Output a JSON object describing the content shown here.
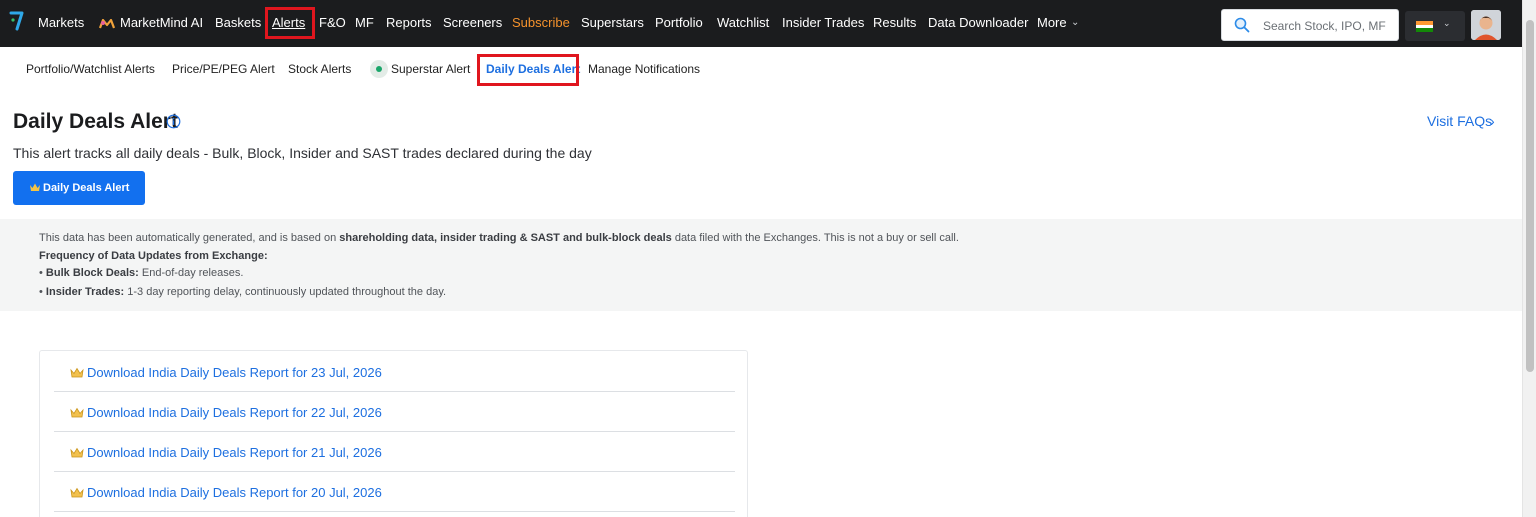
{
  "topnav": {
    "items": [
      {
        "label": "Markets"
      },
      {
        "label": "MarketMind AI"
      },
      {
        "label": "Baskets"
      },
      {
        "label": "Alerts"
      },
      {
        "label": "F&O"
      },
      {
        "label": "MF"
      },
      {
        "label": "Reports"
      },
      {
        "label": "Screeners"
      },
      {
        "label": "Subscribe"
      },
      {
        "label": "Superstars"
      },
      {
        "label": "Portfolio"
      },
      {
        "label": "Watchlist"
      },
      {
        "label": "Insider Trades"
      },
      {
        "label": "Results"
      },
      {
        "label": "Data Downloader"
      },
      {
        "label": "More"
      }
    ],
    "search_placeholder": "Search Stock, IPO, MF",
    "country_flag": "india-flag-icon",
    "accent_subscribe": "#f5922c"
  },
  "subtabs": {
    "items": [
      {
        "label": "Portfolio/Watchlist Alerts"
      },
      {
        "label": "Price/PE/PEG Alert"
      },
      {
        "label": "Stock Alerts"
      },
      {
        "label": "Superstar Alert"
      },
      {
        "label": "Daily Deals Alert"
      },
      {
        "label": "Manage Notifications"
      }
    ],
    "active": "Daily Deals Alert"
  },
  "header": {
    "title": "Daily Deals Alert",
    "faq_link": "Visit FAQs",
    "subtitle": "This alert tracks all daily deals - Bulk, Block, Insider and SAST trades declared during the day",
    "cta_label": "Daily Deals Alert"
  },
  "disclaimer": {
    "line1_pre": "This data has been automatically generated, and is based on ",
    "line1_bold": "shareholding data, insider trading & SAST and bulk-block deals",
    "line1_post": " data filed with the Exchanges. This is not a buy or sell call.",
    "line2": "Frequency of Data Updates from Exchange:",
    "line3_bold": "Bulk Block Deals:",
    "line3_text": " End-of-day releases.",
    "line4_bold": "Insider Trades:",
    "line4_text": " 1-3 day reporting delay, continuously updated throughout the day."
  },
  "reports": {
    "items": [
      {
        "label": "Download India Daily Deals Report for 23 Jul, 2026"
      },
      {
        "label": "Download India Daily Deals Report for 22 Jul, 2026"
      },
      {
        "label": "Download India Daily Deals Report for 21 Jul, 2026"
      },
      {
        "label": "Download India Daily Deals Report for 20 Jul, 2026"
      }
    ]
  },
  "colors": {
    "nav_bg": "#1b1c1e",
    "link_blue": "#1d6fe0",
    "cta_blue": "#1270ef",
    "highlight_red": "#e0161e"
  }
}
